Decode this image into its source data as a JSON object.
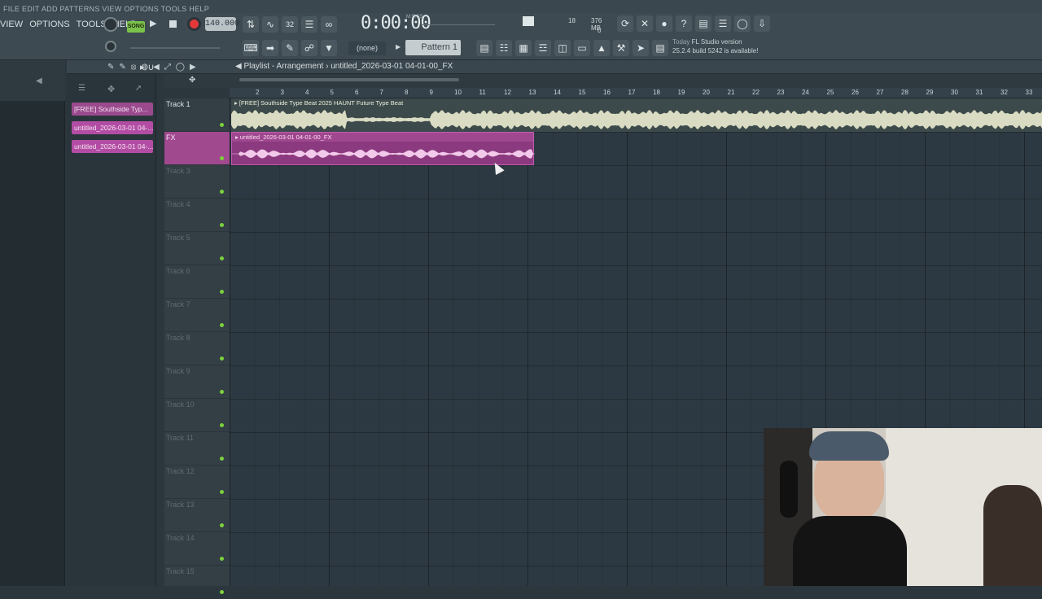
{
  "menu": {
    "items": [
      "VIEW",
      "OPTIONS",
      "TOOLS",
      "HELP"
    ],
    "ghost_text": "FILE EDIT ADD PATTERNS VIEW OPTIONS TOOLS HELP"
  },
  "transport": {
    "song_mode": "SONG",
    "tempo": "140.000",
    "time": "0:00:00",
    "time_sub": "M:S:CS",
    "pattern_none": "(none)",
    "pattern": "Pattern 1"
  },
  "cpu": {
    "value1": "18",
    "mem": "376 MB",
    "voices": "0"
  },
  "news": {
    "today": "Today",
    "line1": "FL Studio version",
    "line2": "25.2.4 build 5242 is available!"
  },
  "playlist": {
    "title": "Playlist - Arrangement",
    "separator": "›",
    "file": "untitled_2026-03-01 04-01-00_FX"
  },
  "picker": {
    "items": [
      "[FREE] Southside Typ...",
      "untitled_2026-03-01 04-...",
      "untitled_2026-03-01 04-..."
    ]
  },
  "ruler": {
    "ticks": [
      "2",
      "3",
      "4",
      "5",
      "6",
      "7",
      "8",
      "9",
      "10",
      "11",
      "12",
      "13",
      "14",
      "15",
      "16",
      "17",
      "18",
      "19",
      "20",
      "21",
      "22",
      "23",
      "24",
      "25",
      "26",
      "27",
      "28",
      "29",
      "30",
      "31",
      "32",
      "33"
    ]
  },
  "tracks": [
    {
      "name": "Track 1"
    },
    {
      "name": "FX"
    },
    {
      "name": "Track 3"
    },
    {
      "name": "Track 4"
    },
    {
      "name": "Track 5"
    },
    {
      "name": "Track 6"
    },
    {
      "name": "Track 7"
    },
    {
      "name": "Track 8"
    },
    {
      "name": "Track 9"
    },
    {
      "name": "Track 10"
    },
    {
      "name": "Track 11"
    },
    {
      "name": "Track 12"
    },
    {
      "name": "Track 13"
    },
    {
      "name": "Track 14"
    },
    {
      "name": "Track 15"
    }
  ],
  "clips": {
    "beat": "[FREE] Southside Type Beat 2025 HAUNT Future Type Beat",
    "fx": "untitled_2026-03-01 04-01-00_FX"
  },
  "colors": {
    "accent_green": "#7bc24a",
    "record": "#e5383b",
    "fx_clip": "#a0488f",
    "audio_clip": "#d9dcc2"
  }
}
